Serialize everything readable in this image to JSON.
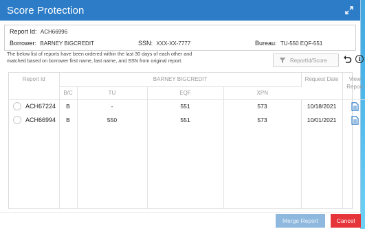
{
  "window": {
    "title": "Score Protection",
    "expand_icon": "expand-arrows-icon"
  },
  "report_info": {
    "report_id_label": "Report Id:",
    "report_id_value": "ACH66996",
    "borrower_label": "Borrower:",
    "borrower_value": "BARNEY BIGCREDIT",
    "ssn_label": "SSN:",
    "ssn_value": "XXX-XX-7777",
    "bureau_label": "Bureau:",
    "bureau_value": "TU-550 EQF-551"
  },
  "notice": {
    "line1": "The below list of reports have been ordered within the last 30 days of each other and",
    "line2": "matched based on borrower first name, last name, and SSN from original report."
  },
  "toolbar": {
    "search_placeholder": "ReportId/Score",
    "filter_icon": "funnel-icon",
    "undo_icon": "undo-icon",
    "info_icon": "info-icon",
    "info_glyph": "i"
  },
  "table": {
    "headers": {
      "report_id": "Report Id",
      "borrower_group": "BARNEY BIGCREDIT",
      "request_date": "Request Date",
      "view_report": "View Report",
      "bc": "B/C",
      "tu": "TU",
      "eqf": "EQF",
      "xpn": "XPN"
    },
    "rows": [
      {
        "report_id": "ACH67224",
        "bc": "B",
        "tu": "-",
        "eqf": "551",
        "xpn": "573",
        "request_date": "10/18/2021"
      },
      {
        "report_id": "ACH66994",
        "bc": "B",
        "tu": "550",
        "eqf": "551",
        "xpn": "573",
        "request_date": "10/01/2021"
      }
    ]
  },
  "footer": {
    "merge_label": "Merge Report",
    "cancel_label": "Cancel"
  },
  "colors": {
    "titlebar": "#2c7cc7",
    "merge_disabled": "#8eb8dd",
    "cancel": "#e5343a",
    "doc_icon": "#2c7cc7"
  }
}
